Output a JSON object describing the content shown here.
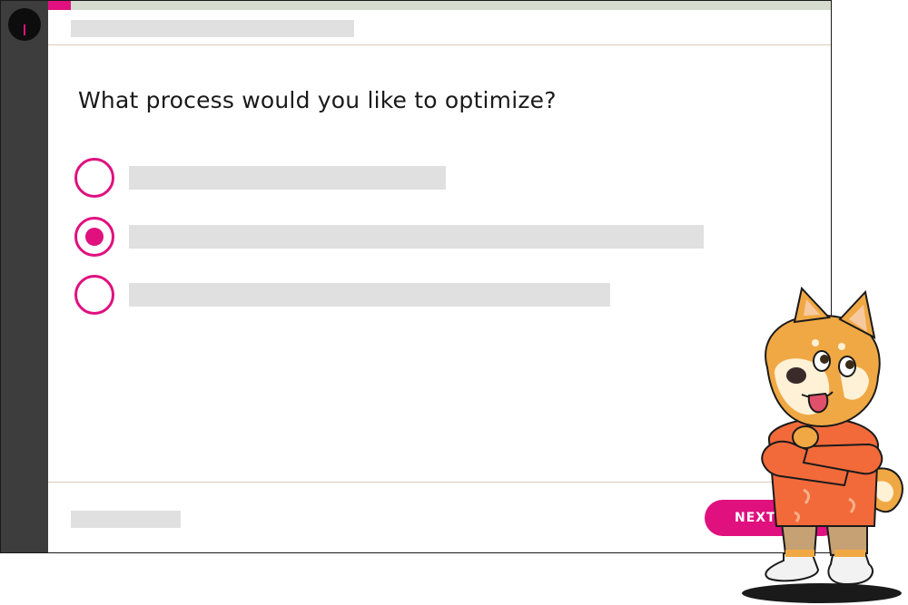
{
  "question": {
    "text": "What process would you like to optimize?"
  },
  "options": [
    {
      "selected": false
    },
    {
      "selected": true
    },
    {
      "selected": false
    }
  ],
  "footer": {
    "next_label": "NEXT"
  },
  "colors": {
    "accent": "#e0107f",
    "sidebar": "#3d3d3d",
    "placeholder": "#e0e0e0"
  },
  "icons": {
    "mascot": "shiba-dog-mascot-icon",
    "logo": "app-logo-icon"
  }
}
